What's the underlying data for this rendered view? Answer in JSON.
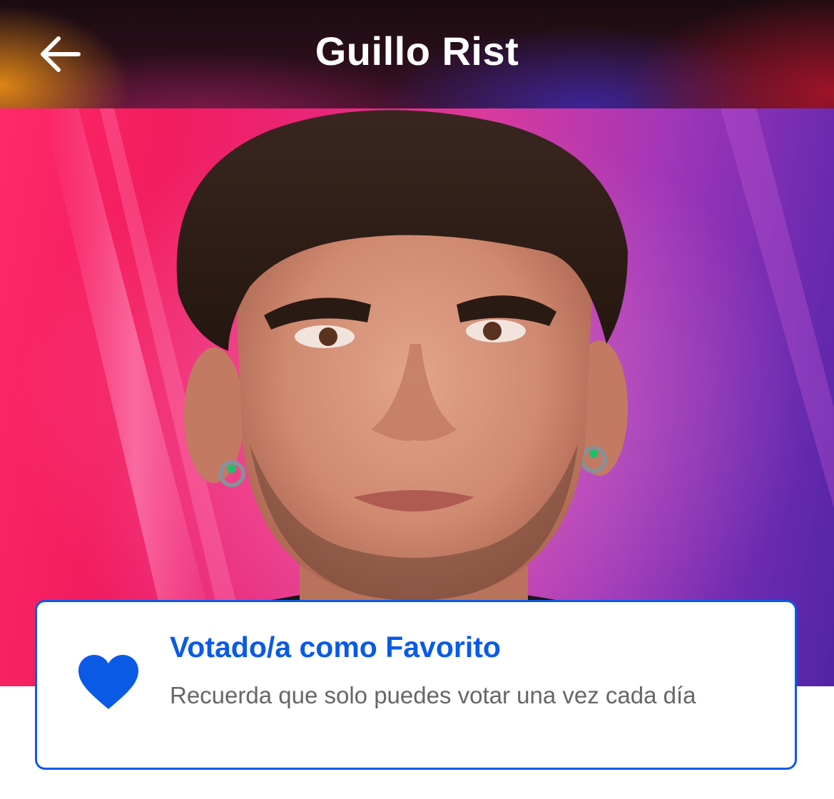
{
  "header": {
    "title": "Guillo Rist",
    "back_icon": "arrow-left-icon"
  },
  "hero": {
    "subject": "contestant-portrait"
  },
  "vote_card": {
    "icon": "heart-icon",
    "title": "Votado/a como Favorito",
    "message": "Recuerda que solo puedes votar una vez cada día"
  },
  "colors": {
    "accent": "#0a5ae6",
    "title_text": "#ffffff",
    "message_text": "#666666"
  }
}
